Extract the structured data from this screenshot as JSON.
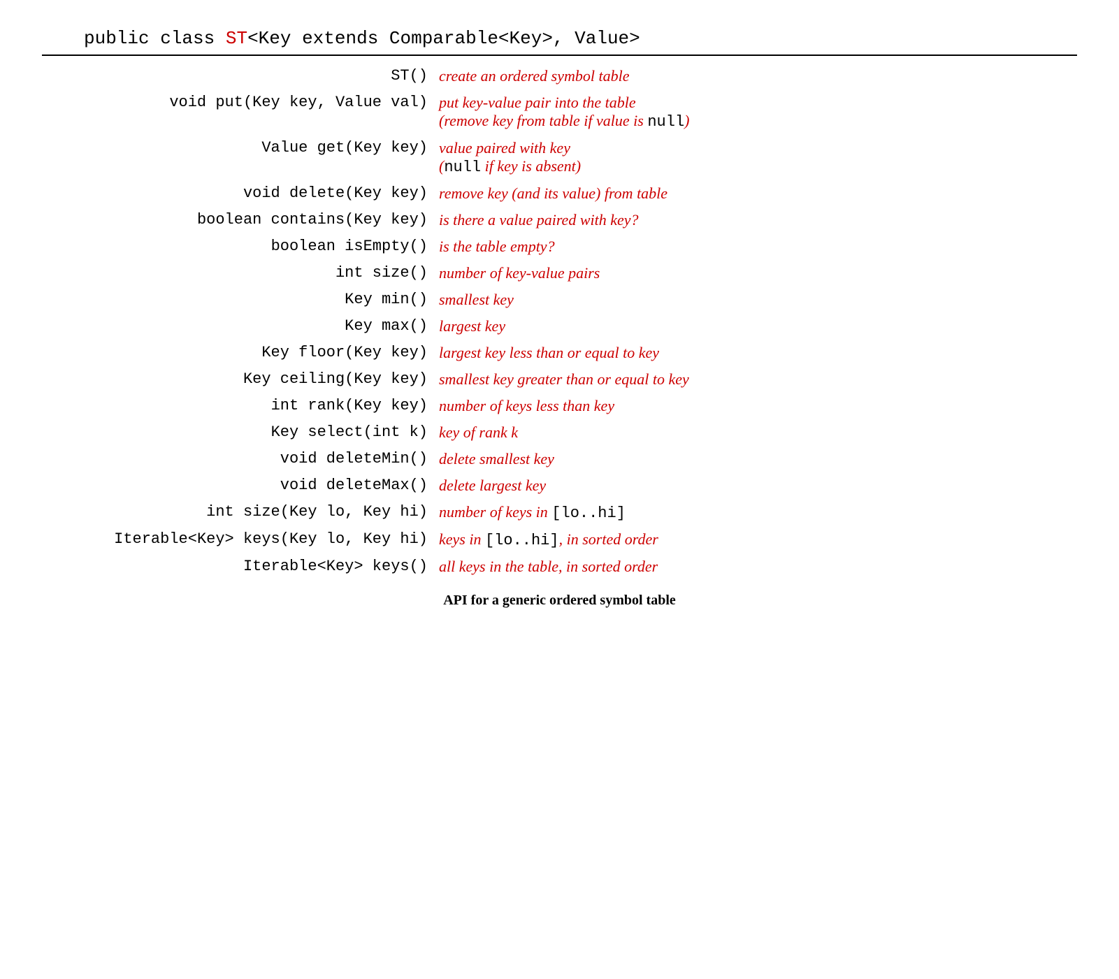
{
  "header": {
    "prefix": "public class ",
    "classname": "ST",
    "suffix": "<Key extends Comparable<Key>, Value>"
  },
  "caption": "API for a generic ordered symbol table",
  "rows": [
    {
      "method": "ST()",
      "desc_html": "create an ordered symbol table"
    },
    {
      "method": "void put(Key key, Value val)",
      "desc_html": "put key-value pair into the table<br>(<em>remove</em> key from table if value is <span class=\"mono\">null</span>)"
    },
    {
      "method": "Value get(Key key)",
      "desc_html": "value paired with key<br>(<span class=\"mono\">null</span> <em>if</em> key <em>is absent</em>)"
    },
    {
      "method": "void delete(Key key)",
      "desc_html": "<em>remove</em> key (<em>and its value</em>) from table"
    },
    {
      "method": "boolean contains(Key key)",
      "desc_html": "<em>is there a value paired with</em> key?"
    },
    {
      "method": "boolean isEmpty()",
      "desc_html": "<em>is the table empty?</em>"
    },
    {
      "method": "int size()",
      "desc_html": "<em>number of key-value pairs</em>"
    },
    {
      "method": "Key min()",
      "desc_html": "<em>smallest key</em>"
    },
    {
      "method": "Key max()",
      "desc_html": "<em>largest key</em>"
    },
    {
      "method": "Key floor(Key key)",
      "desc_html": "<em>largest key less than or equal to</em> key"
    },
    {
      "method": "Key ceiling(Key key)",
      "desc_html": "<em>smallest key greater than or equal to</em> key"
    },
    {
      "method": "int rank(Key key)",
      "desc_html": "<em>number of keys less than</em> key"
    },
    {
      "method": "Key select(int k)",
      "desc_html": "<em>key of rank</em> k"
    },
    {
      "method": "void deleteMin()",
      "desc_html": "<em>delete smallest key</em>"
    },
    {
      "method": "void deleteMax()",
      "desc_html": "<em>delete largest key</em>"
    },
    {
      "method": "int size(Key lo, Key hi)",
      "desc_html": "<em>number of keys in</em> <span class=\"mono\">[lo..hi]</span>"
    },
    {
      "method": "Iterable<Key> keys(Key lo, Key hi)",
      "desc_html": "<em>keys in</em> <span class=\"mono\">[lo..hi]</span>, <em>in sorted order</em>"
    },
    {
      "method": "Iterable<Key> keys()",
      "desc_html": "<em>all keys in the table, in sorted order</em>"
    }
  ]
}
